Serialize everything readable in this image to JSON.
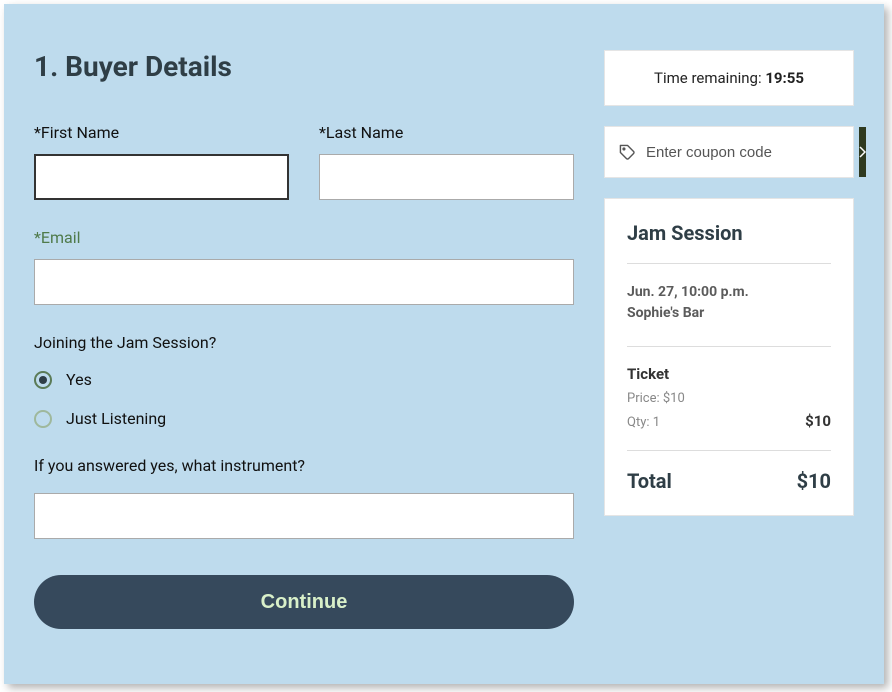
{
  "heading": "1.  Buyer Details",
  "labels": {
    "first_name": "*First Name",
    "last_name": "*Last Name",
    "email": "*Email",
    "joining_q": "Joining the Jam Session?",
    "instrument_q": "If you answered yes, what instrument?"
  },
  "radio": {
    "yes": "Yes",
    "just_listening": "Just Listening"
  },
  "continue_label": "Continue",
  "timer": {
    "prefix": "Time remaining: ",
    "value": "19:55"
  },
  "coupon": {
    "placeholder": "Enter coupon code"
  },
  "summary": {
    "event_title": "Jam Session",
    "datetime": "Jun. 27, 10:00 p.m.",
    "venue": "Sophie's Bar",
    "ticket_name": "Ticket",
    "price_label": "Price: $10",
    "qty_label": "Qty: 1",
    "line_total": "$10",
    "total_label": "Total",
    "total_amount": "$10"
  }
}
